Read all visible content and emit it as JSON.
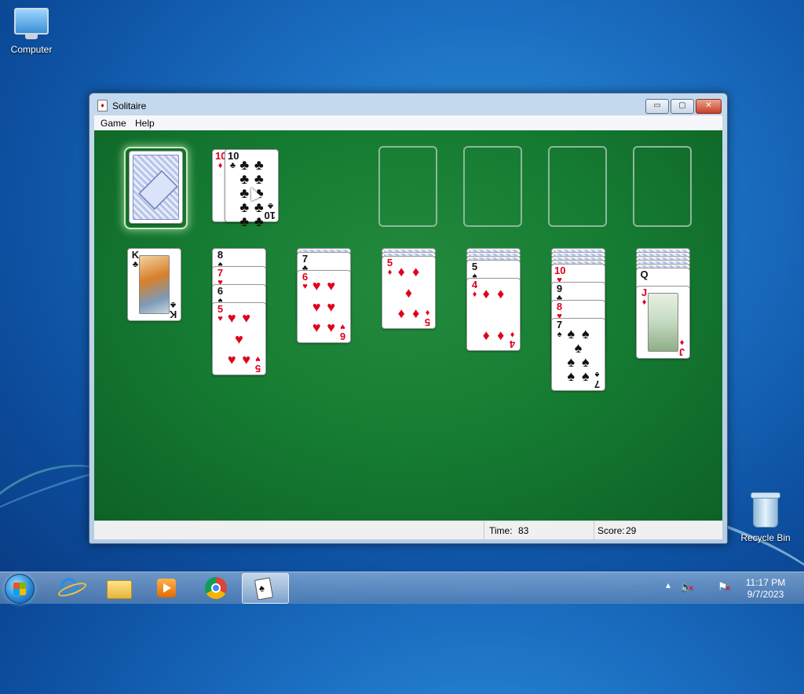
{
  "desktop": {
    "icons": [
      {
        "label": "Computer"
      },
      {
        "label": "Recycle Bin"
      }
    ]
  },
  "window": {
    "title": "Solitaire",
    "controls": {
      "minimize": "▭",
      "maximize": "▢",
      "close": "✕"
    },
    "menu": [
      "Game",
      "Help"
    ]
  },
  "game": {
    "stock": {
      "face_down": true
    },
    "waste": [
      {
        "rank": "10",
        "suit": "♦",
        "color": "red"
      },
      {
        "rank": "10",
        "suit": "♣",
        "color": "black"
      }
    ],
    "foundations": [
      {
        "empty": true
      },
      {
        "empty": true
      },
      {
        "empty": true
      },
      {
        "empty": true
      }
    ],
    "tableau": [
      {
        "hidden": 0,
        "cards": [
          {
            "rank": "K",
            "suit": "♣",
            "color": "black"
          }
        ]
      },
      {
        "hidden": 0,
        "cards": [
          {
            "rank": "8",
            "suit": "♠",
            "color": "black"
          },
          {
            "rank": "7",
            "suit": "♥",
            "color": "red"
          },
          {
            "rank": "6",
            "suit": "♠",
            "color": "black"
          },
          {
            "rank": "5",
            "suit": "♥",
            "color": "red"
          }
        ]
      },
      {
        "hidden": 1,
        "cards": [
          {
            "rank": "7",
            "suit": "♣",
            "color": "black"
          },
          {
            "rank": "6",
            "suit": "♥",
            "color": "red"
          }
        ]
      },
      {
        "hidden": 2,
        "cards": [
          {
            "rank": "5",
            "suit": "♦",
            "color": "red"
          }
        ]
      },
      {
        "hidden": 3,
        "cards": [
          {
            "rank": "5",
            "suit": "♠",
            "color": "black"
          },
          {
            "rank": "4",
            "suit": "♦",
            "color": "red"
          }
        ]
      },
      {
        "hidden": 4,
        "cards": [
          {
            "rank": "10",
            "suit": "♥",
            "color": "red"
          },
          {
            "rank": "9",
            "suit": "♣",
            "color": "black"
          },
          {
            "rank": "8",
            "suit": "♥",
            "color": "red"
          },
          {
            "rank": "7",
            "suit": "♠",
            "color": "black"
          }
        ]
      },
      {
        "hidden": 5,
        "cards": [
          {
            "rank": "Q",
            "suit": "",
            "color": "black"
          },
          {
            "rank": "J",
            "suit": "♦",
            "color": "red"
          }
        ]
      }
    ]
  },
  "status": {
    "time_label": "Time:",
    "time_value": "83",
    "score_label": "Score:",
    "score_value": "29"
  },
  "taskbar": {
    "pinned": [
      "start-orb",
      "internet-explorer-icon",
      "file-explorer-icon",
      "media-player-icon",
      "chrome-icon",
      "solitaire-icon"
    ],
    "clock_time": "11:17 PM",
    "clock_date": "9/7/2023"
  },
  "colors": {
    "felt": "#167d33",
    "red_suit": "#e0001b",
    "black_suit": "#111111",
    "slot_outline": "#8fb79a"
  }
}
